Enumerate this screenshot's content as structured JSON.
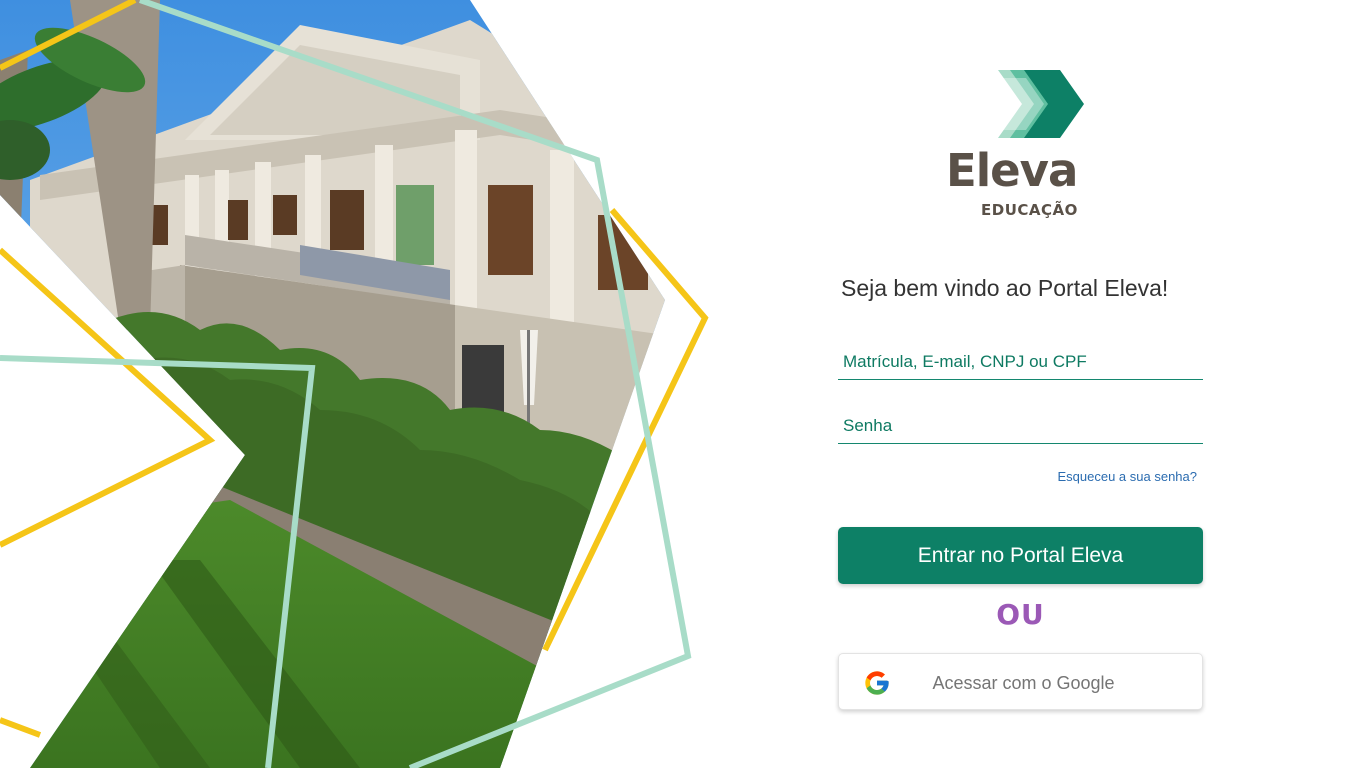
{
  "brand": {
    "name": "Eleva",
    "tagline": "EDUCAÇÃO",
    "colors": {
      "primary": "#0d8066",
      "accent_light": "#a8dcc8",
      "accent_yellow": "#f5c518",
      "text_dark": "#5a5148"
    }
  },
  "welcome": "Seja bem vindo ao Portal Eleva!",
  "form": {
    "user_placeholder": "Matrícula, E-mail, CNPJ ou CPF",
    "user_value": "",
    "password_placeholder": "Senha",
    "password_value": "",
    "forgot_label": "Esqueceu a sua senha?",
    "submit_label": "Entrar no Portal Eleva"
  },
  "separator": "OU",
  "google": {
    "label": "Acessar com o Google",
    "icon": "google-g-icon"
  },
  "hero": {
    "icon": "campus-building-photo"
  }
}
